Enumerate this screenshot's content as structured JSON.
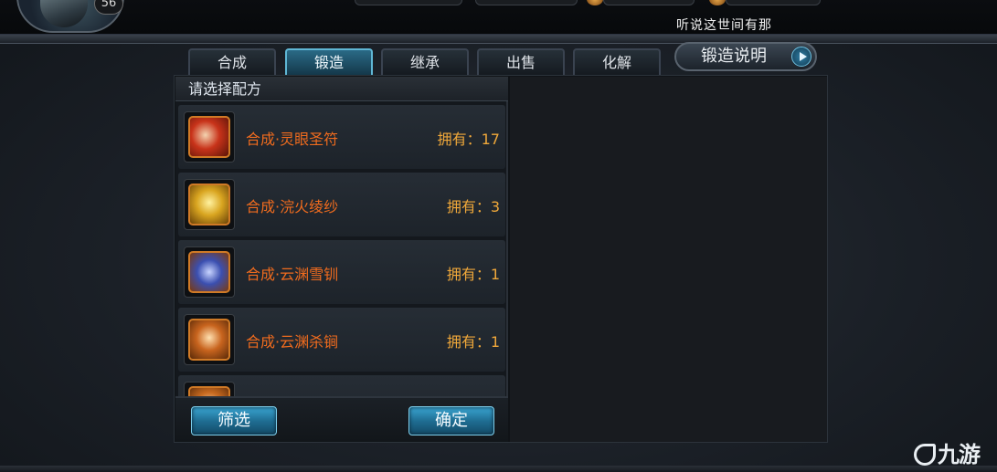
{
  "hud": {
    "level": "56",
    "notice": "听说这世间有那"
  },
  "tabs": [
    {
      "label": "合成",
      "active": false
    },
    {
      "label": "锻造",
      "active": true
    },
    {
      "label": "继承",
      "active": false
    },
    {
      "label": "出售",
      "active": false
    },
    {
      "label": "化解",
      "active": false
    }
  ],
  "help_button": {
    "label": "锻造说明"
  },
  "recipe_panel": {
    "title": "请选择配方",
    "items": [
      {
        "name": "合成·灵眼圣符",
        "owned": "拥有：17",
        "icon": "red-talisman-icon",
        "color": "#c8331a"
      },
      {
        "name": "合成·浣火绫纱",
        "owned": "拥有：3",
        "icon": "gold-scroll-icon",
        "color": "#d9a520"
      },
      {
        "name": "合成·云渊雪钏",
        "owned": "拥有：1",
        "icon": "blue-scroll-icon",
        "color": "#3b4fb0"
      },
      {
        "name": "合成·云渊杀锏",
        "owned": "拥有：1",
        "icon": "orange-scroll-icon",
        "color": "#c8641e"
      }
    ],
    "filter_label": "筛选",
    "confirm_label": "确定"
  },
  "watermark": {
    "text": "九游"
  }
}
